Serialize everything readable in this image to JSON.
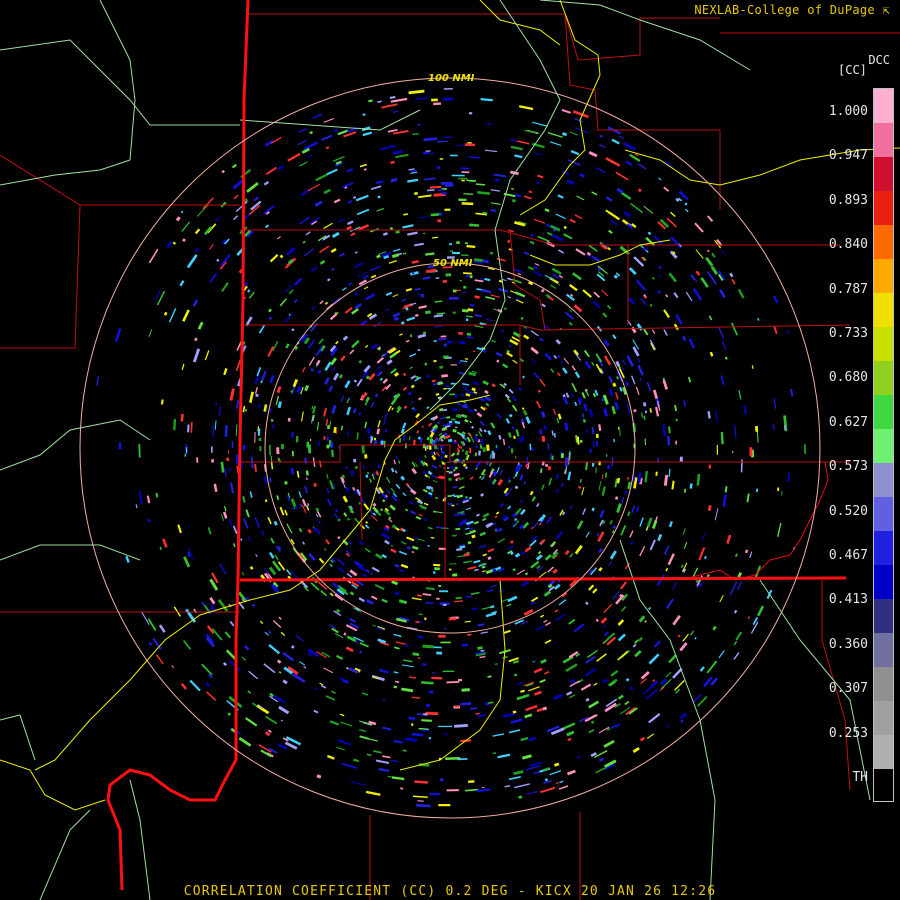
{
  "header": {
    "credit": "NEXLAB-College of DuPage",
    "credit_icon": "arrow-icon"
  },
  "legend": {
    "product": "DCC",
    "unit": "[CC]",
    "ticks": [
      "1.000",
      "0.947",
      "0.893",
      "0.840",
      "0.787",
      "0.733",
      "0.680",
      "0.627",
      "0.573",
      "0.520",
      "0.467",
      "0.413",
      "0.360",
      "0.307",
      "0.253",
      "TH"
    ],
    "colors": [
      "#ffb0d0",
      "#f070a0",
      "#d01030",
      "#e82010",
      "#ff6a00",
      "#ffa800",
      "#f0e000",
      "#c8e000",
      "#90d020",
      "#40d840",
      "#70f070",
      "#9090d0",
      "#6060e0",
      "#2020e0",
      "#0000c8",
      "#303080",
      "#7070a0",
      "#909090",
      "#a0a0a0",
      "#b0b0b0",
      "#000000"
    ]
  },
  "range_rings": [
    {
      "label": "100 NMI"
    },
    {
      "label": "50 NMI"
    }
  ],
  "footer": {
    "caption": "CORRELATION COEFFICIENT (CC) 0.2 DEG - KICX 20 JAN 26 12:26"
  },
  "colors": {
    "state_border": "#ff1010",
    "county_border": "#c01010",
    "highway": "#f0f000",
    "boundary": "#a0e0a0",
    "ring": "#f0b0a0"
  }
}
